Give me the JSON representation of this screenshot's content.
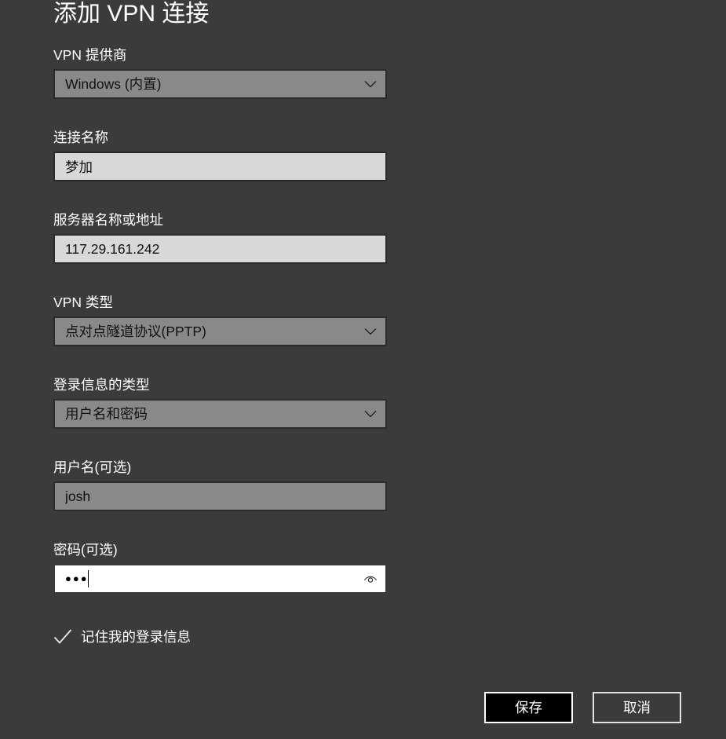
{
  "window": {
    "title": "添加 VPN 连接"
  },
  "form": {
    "vpn_provider": {
      "label": "VPN 提供商",
      "value": "Windows (内置)"
    },
    "connection_name": {
      "label": "连接名称",
      "value": "梦加"
    },
    "server_address": {
      "label": "服务器名称或地址",
      "value": "117.29.161.242"
    },
    "vpn_type": {
      "label": "VPN 类型",
      "value": "点对点隧道协议(PPTP)"
    },
    "sign_in_info_type": {
      "label": "登录信息的类型",
      "value": "用户名和密码"
    },
    "username": {
      "label": "用户名(可选)",
      "value": "josh"
    },
    "password": {
      "label": "密码(可选)",
      "masked_value": "●●●"
    },
    "remember_sign_in": {
      "label": "记住我的登录信息",
      "checked": true
    }
  },
  "buttons": {
    "save": "保存",
    "cancel": "取消"
  },
  "icons": {
    "dropdown_arrow": "chevron-down-icon",
    "password_reveal": "eye-icon",
    "checkbox_check": "checkmark-icon"
  },
  "colors": {
    "background": "#3b3b3b",
    "combo_bg": "#898989",
    "field_border": "#2b2b2b",
    "input_light_bg": "#d8d8d8",
    "input_dim_bg": "#898989",
    "input_active_bg": "#ffffff",
    "primary_button_bg": "#000000",
    "button_border": "#ffffff"
  }
}
